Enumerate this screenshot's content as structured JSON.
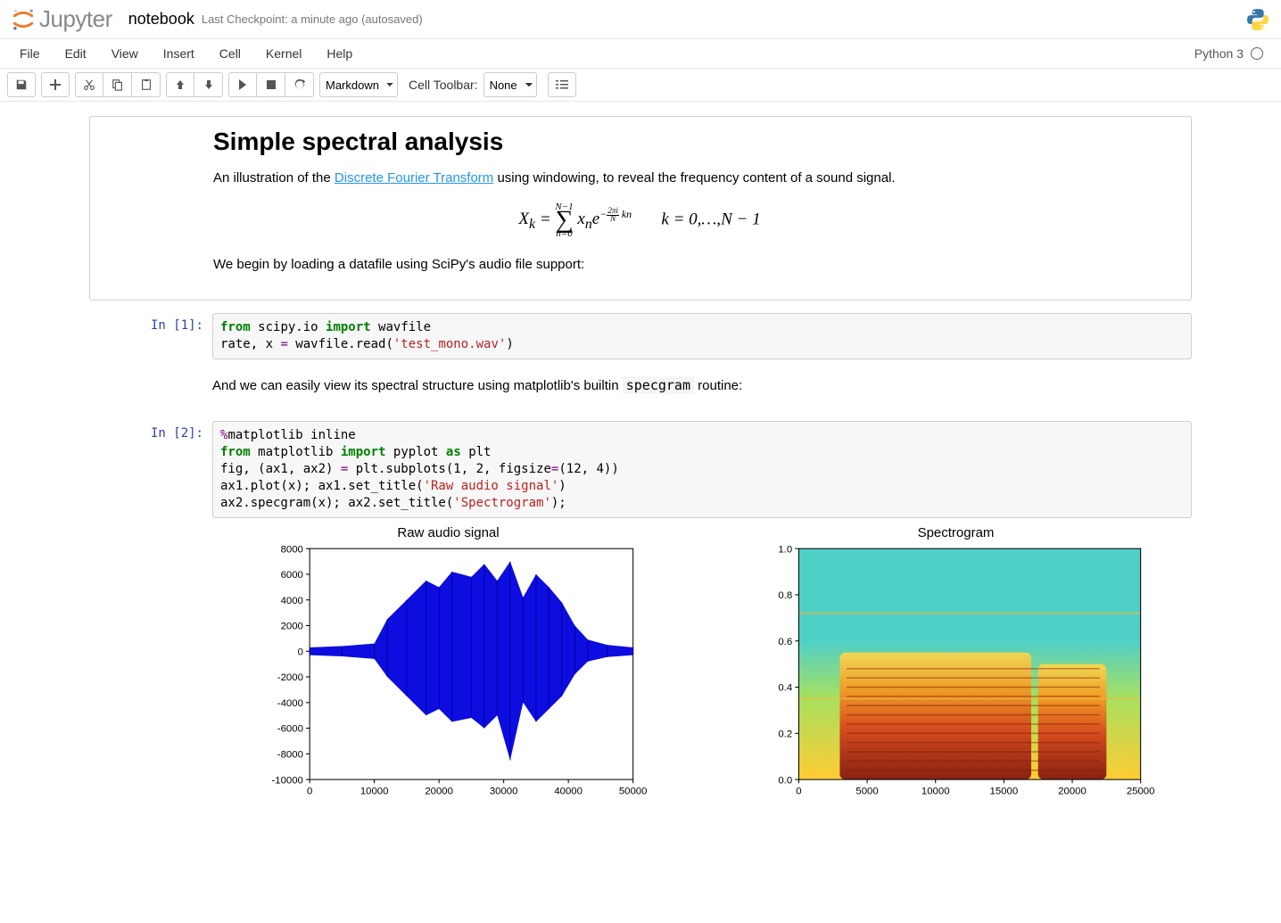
{
  "header": {
    "logo_text": "Jupyter",
    "nb_title": "notebook",
    "checkpoint": "Last Checkpoint: a minute ago (autosaved)"
  },
  "menubar": {
    "items": [
      "File",
      "Edit",
      "View",
      "Insert",
      "Cell",
      "Kernel",
      "Help"
    ],
    "kernel_name": "Python 3"
  },
  "toolbar": {
    "celltype": "Markdown",
    "cell_toolbar_label": "Cell Toolbar:",
    "cell_toolbar_value": "None"
  },
  "cells": {
    "md1": {
      "title": "Simple spectral analysis",
      "p1a": "An illustration of the ",
      "p1_link": "Discrete Fourier Transform",
      "p1b": " using windowing, to reveal the frequency content of a sound signal.",
      "math": "X_k = ∑_{n=0}^{N-1} x_n e^{-(2πi/N)kn}     k = 0,…,N-1",
      "p2": "We begin by loading a datafile using SciPy's audio file support:"
    },
    "code1": {
      "prompt": "In [1]:",
      "tokens": [
        {
          "t": "from ",
          "c": "kw-green"
        },
        {
          "t": "scipy.io ",
          "c": ""
        },
        {
          "t": "import ",
          "c": "kw-green"
        },
        {
          "t": "wavfile\n",
          "c": ""
        },
        {
          "t": "rate, x ",
          "c": ""
        },
        {
          "t": "= ",
          "c": "kw-purple"
        },
        {
          "t": "wavfile.read(",
          "c": ""
        },
        {
          "t": "'test_mono.wav'",
          "c": "kw-red"
        },
        {
          "t": ")",
          "c": ""
        }
      ]
    },
    "md2": {
      "p1a": "And we can easily view its spectral structure using matplotlib's builtin ",
      "p1_code": "specgram",
      "p1b": " routine:"
    },
    "code2": {
      "prompt": "In [2]:",
      "tokens": [
        {
          "t": "%",
          "c": "kw-purple"
        },
        {
          "t": "matplotlib",
          "c": ""
        },
        {
          "t": " inline\n",
          "c": ""
        },
        {
          "t": "from ",
          "c": "kw-green"
        },
        {
          "t": "matplotlib ",
          "c": ""
        },
        {
          "t": "import ",
          "c": "kw-green"
        },
        {
          "t": "pyplot ",
          "c": ""
        },
        {
          "t": "as ",
          "c": "kw-green"
        },
        {
          "t": "plt\n",
          "c": ""
        },
        {
          "t": "fig, (ax1, ax2) ",
          "c": ""
        },
        {
          "t": "= ",
          "c": "kw-purple"
        },
        {
          "t": "plt.subplots(",
          "c": ""
        },
        {
          "t": "1",
          "c": ""
        },
        {
          "t": ", ",
          "c": ""
        },
        {
          "t": "2",
          "c": ""
        },
        {
          "t": ", figsize",
          "c": ""
        },
        {
          "t": "=",
          "c": "kw-purple"
        },
        {
          "t": "(",
          "c": ""
        },
        {
          "t": "12",
          "c": ""
        },
        {
          "t": ", ",
          "c": ""
        },
        {
          "t": "4",
          "c": ""
        },
        {
          "t": "))\n",
          "c": ""
        },
        {
          "t": "ax1.plot(x); ax1.set_title(",
          "c": ""
        },
        {
          "t": "'Raw audio signal'",
          "c": "kw-red"
        },
        {
          "t": ")\n",
          "c": ""
        },
        {
          "t": "ax2.specgram(x); ax2.set_title(",
          "c": ""
        },
        {
          "t": "'Spectrogram'",
          "c": "kw-red"
        },
        {
          "t": ");",
          "c": ""
        }
      ]
    }
  },
  "chart_data": [
    {
      "type": "line",
      "title": "Raw audio signal",
      "xlabel": "",
      "ylabel": "",
      "xlim": [
        0,
        50000
      ],
      "ylim": [
        -10000,
        8000
      ],
      "xticks": [
        0,
        10000,
        20000,
        30000,
        40000,
        50000
      ],
      "yticks": [
        -10000,
        -8000,
        -6000,
        -4000,
        -2000,
        0,
        2000,
        4000,
        6000,
        8000
      ],
      "note": "dense audio waveform; envelope approximated",
      "envelope_x": [
        0,
        5000,
        10000,
        12000,
        15000,
        18000,
        20000,
        22000,
        25000,
        27000,
        29000,
        31000,
        33000,
        35000,
        37000,
        39000,
        41000,
        43000,
        46000,
        50000
      ],
      "envelope_pos": [
        300,
        400,
        600,
        2500,
        4000,
        5500,
        5000,
        6200,
        5800,
        6800,
        5500,
        7000,
        4200,
        6000,
        5000,
        3800,
        2000,
        900,
        500,
        300
      ],
      "envelope_neg": [
        -300,
        -400,
        -600,
        -2000,
        -3500,
        -5000,
        -4500,
        -5500,
        -5200,
        -6000,
        -5000,
        -8500,
        -4000,
        -5500,
        -4500,
        -3500,
        -1800,
        -800,
        -450,
        -300
      ]
    },
    {
      "type": "heatmap",
      "title": "Spectrogram",
      "xlabel": "",
      "ylabel": "",
      "xlim": [
        0,
        25000
      ],
      "ylim": [
        0.0,
        1.0
      ],
      "xticks": [
        0,
        5000,
        10000,
        15000,
        20000,
        25000
      ],
      "yticks": [
        0.0,
        0.2,
        0.4,
        0.6,
        0.8,
        1.0
      ],
      "colormap": "viridis-like (cyan background, yellow/orange/red energy bands concentrated below 0.5)"
    }
  ]
}
